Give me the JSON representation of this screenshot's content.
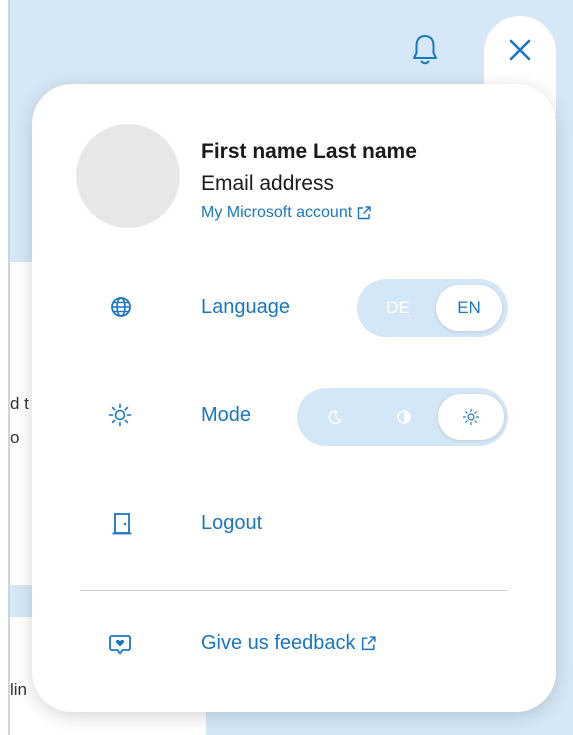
{
  "colors": {
    "accent": "#1877c4",
    "background_page": "#d6e8f7",
    "toggle_track": "#d4e7f6",
    "avatar": "#e7e7e7"
  },
  "header": {
    "bell_icon": "bell-icon",
    "close_icon": "close-icon"
  },
  "background": {
    "text_lines": [
      "d t",
      "o",
      "lin"
    ]
  },
  "user": {
    "name": "First name Last name",
    "email": "Email address",
    "account_link": "My Microsoft account",
    "account_link_icon": "external-link-icon"
  },
  "language": {
    "icon": "globe-icon",
    "label": "Language",
    "options": [
      "DE",
      "EN"
    ],
    "selected": "EN"
  },
  "mode": {
    "icon": "sun-icon",
    "label": "Mode",
    "options": [
      "dark",
      "auto",
      "light"
    ],
    "option_icons": [
      "moon-icon",
      "contrast-icon",
      "sun-icon"
    ],
    "selected": "light"
  },
  "logout": {
    "icon": "door-icon",
    "label": "Logout"
  },
  "feedback": {
    "icon": "heart-message-icon",
    "label": "Give us feedback",
    "link_icon": "external-link-icon"
  }
}
